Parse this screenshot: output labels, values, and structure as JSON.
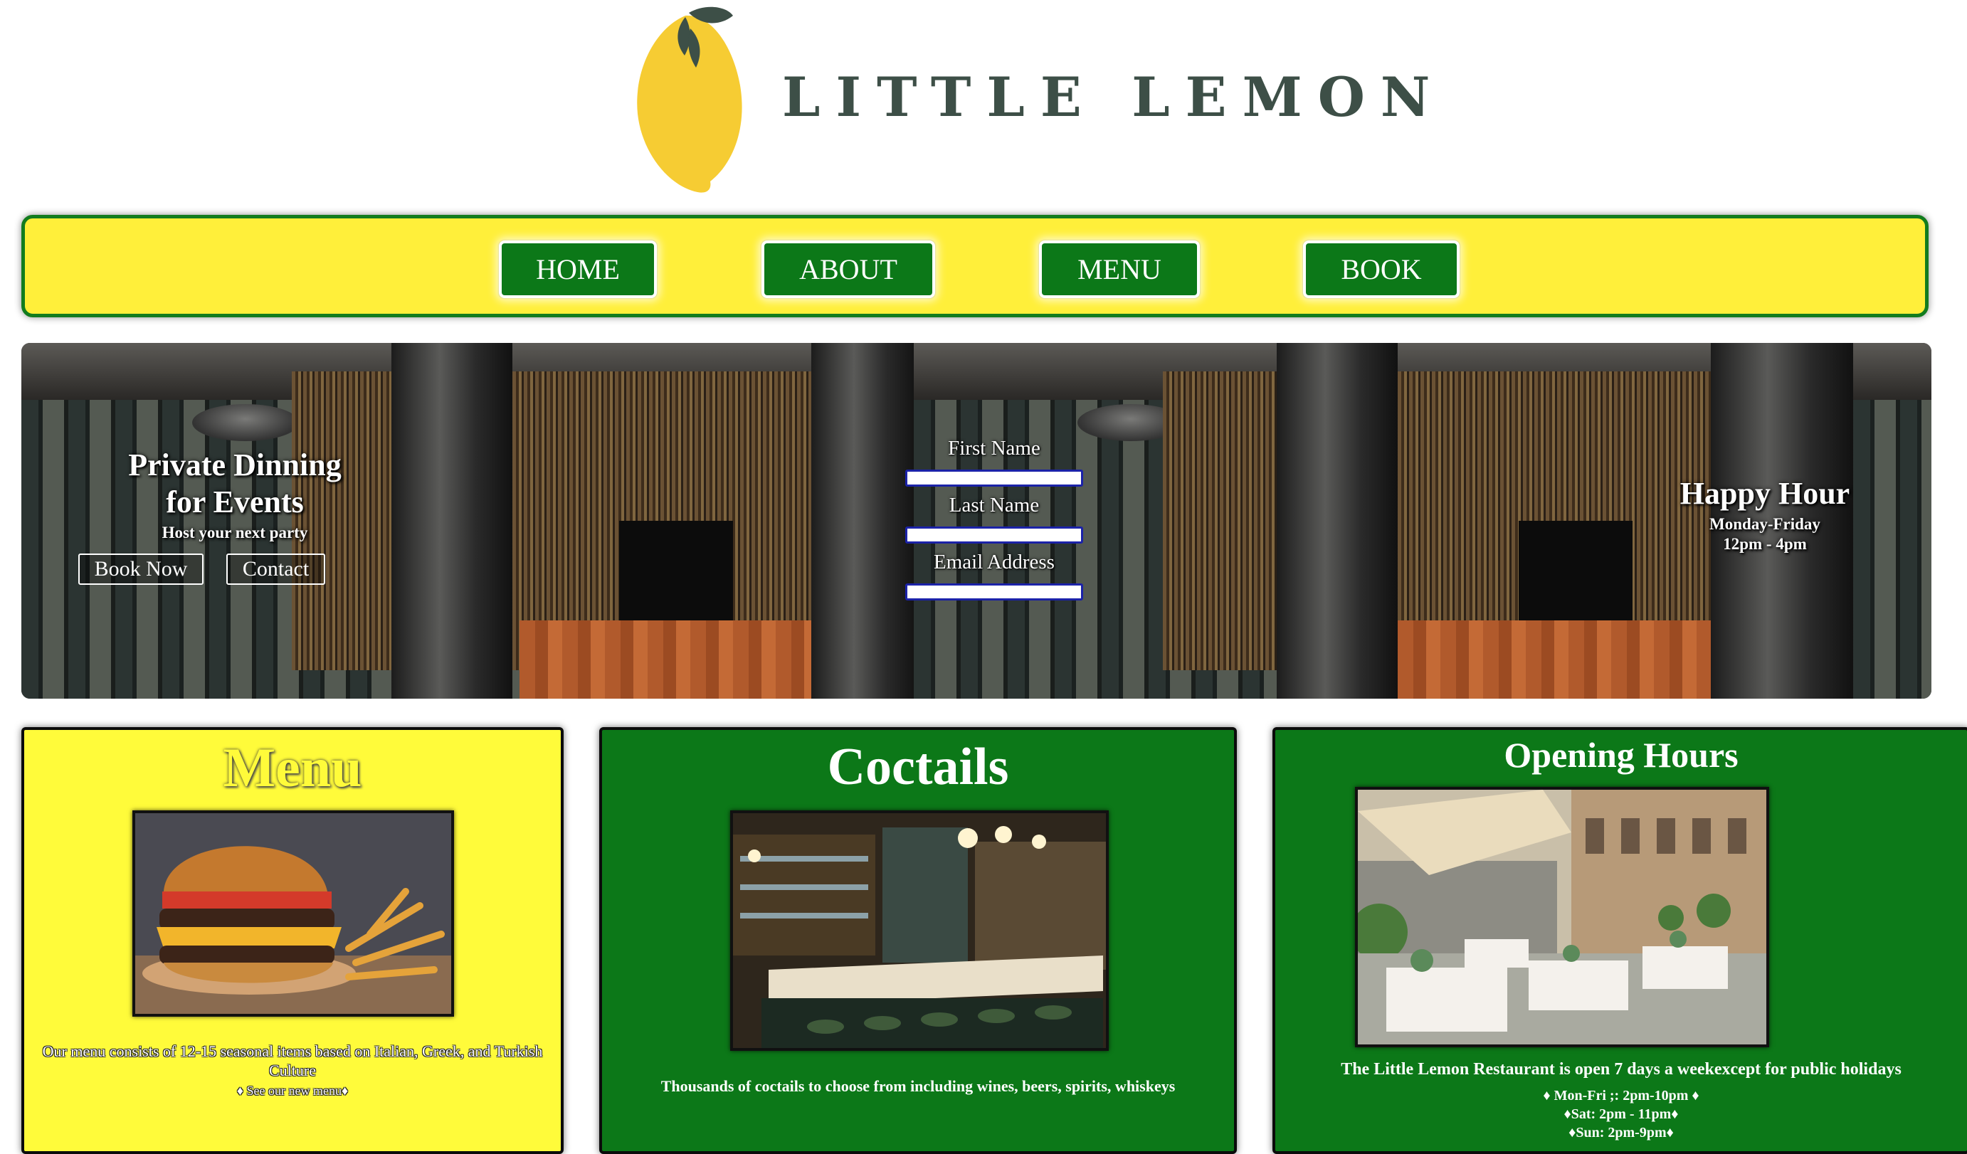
{
  "brand": {
    "name": "LITTLE LEMON",
    "logo_icon": "lemon-icon"
  },
  "nav": {
    "items": [
      {
        "label": "HOME"
      },
      {
        "label": "ABOUT"
      },
      {
        "label": "MENU"
      },
      {
        "label": "BOOK"
      }
    ]
  },
  "hero": {
    "private": {
      "title_line1": "Private Dinning",
      "title_line2": "for Events",
      "subtitle": "Host your next party",
      "book_label": "Book Now",
      "contact_label": "Contact"
    },
    "form": {
      "first_name_label": "First Name",
      "last_name_label": "Last Name",
      "email_label": "Email Address"
    },
    "happy_hour": {
      "title": "Happy Hour",
      "days": "Monday-Friday",
      "hours": "12pm - 4pm"
    }
  },
  "cards": {
    "menu": {
      "title": "Menu",
      "photo": "burger-photo",
      "description": "Our menu consists of 12-15 seasonal items based on Italian, Greek, and Turkish Culture",
      "link": "♦ See our new menu♦"
    },
    "cocktails": {
      "title": "Coctails",
      "photo": "bar-photo",
      "description": "Thousands of coctails to choose from including wines, beers, spirits, whiskeys"
    },
    "hours": {
      "title": "Opening Hours",
      "photo": "courtyard-photo",
      "description": "The Little Lemon Restaurant is open 7 days a weekexcept for public holidays",
      "weekdays": "♦ Mon-Fri ;: 2pm-10pm ♦",
      "saturday": "♦Sat: 2pm - 11pm♦",
      "sunday": "♦Sun: 2pm-9pm♦"
    }
  },
  "colors": {
    "yellow": "#ffef3a",
    "green": "#0c7818",
    "dark_green": "#3d4f47"
  }
}
